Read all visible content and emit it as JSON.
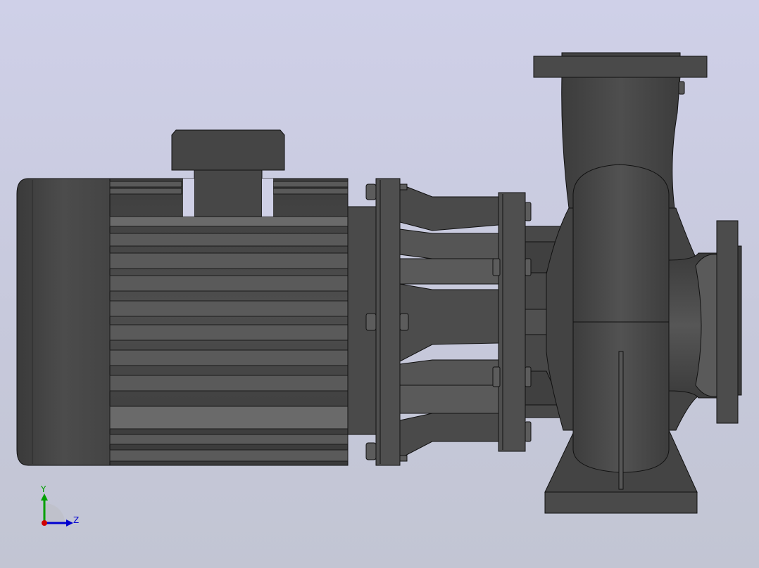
{
  "viewport": {
    "background_top": "#cfd0e8",
    "background_bottom": "#c2c5d3",
    "model_color": "#474747",
    "edge_color": "#000000"
  },
  "model": {
    "icon": "centrifugal-pump-icon",
    "parts": [
      "motor",
      "terminal-box",
      "bracket",
      "coupling",
      "volute-casing",
      "discharge-flange",
      "suction-flange",
      "support-foot"
    ]
  },
  "triad": {
    "y_label": "Y",
    "z_label": "Z",
    "y_color": "#00a000",
    "z_color": "#0000d0",
    "x_color": "#d00000"
  }
}
